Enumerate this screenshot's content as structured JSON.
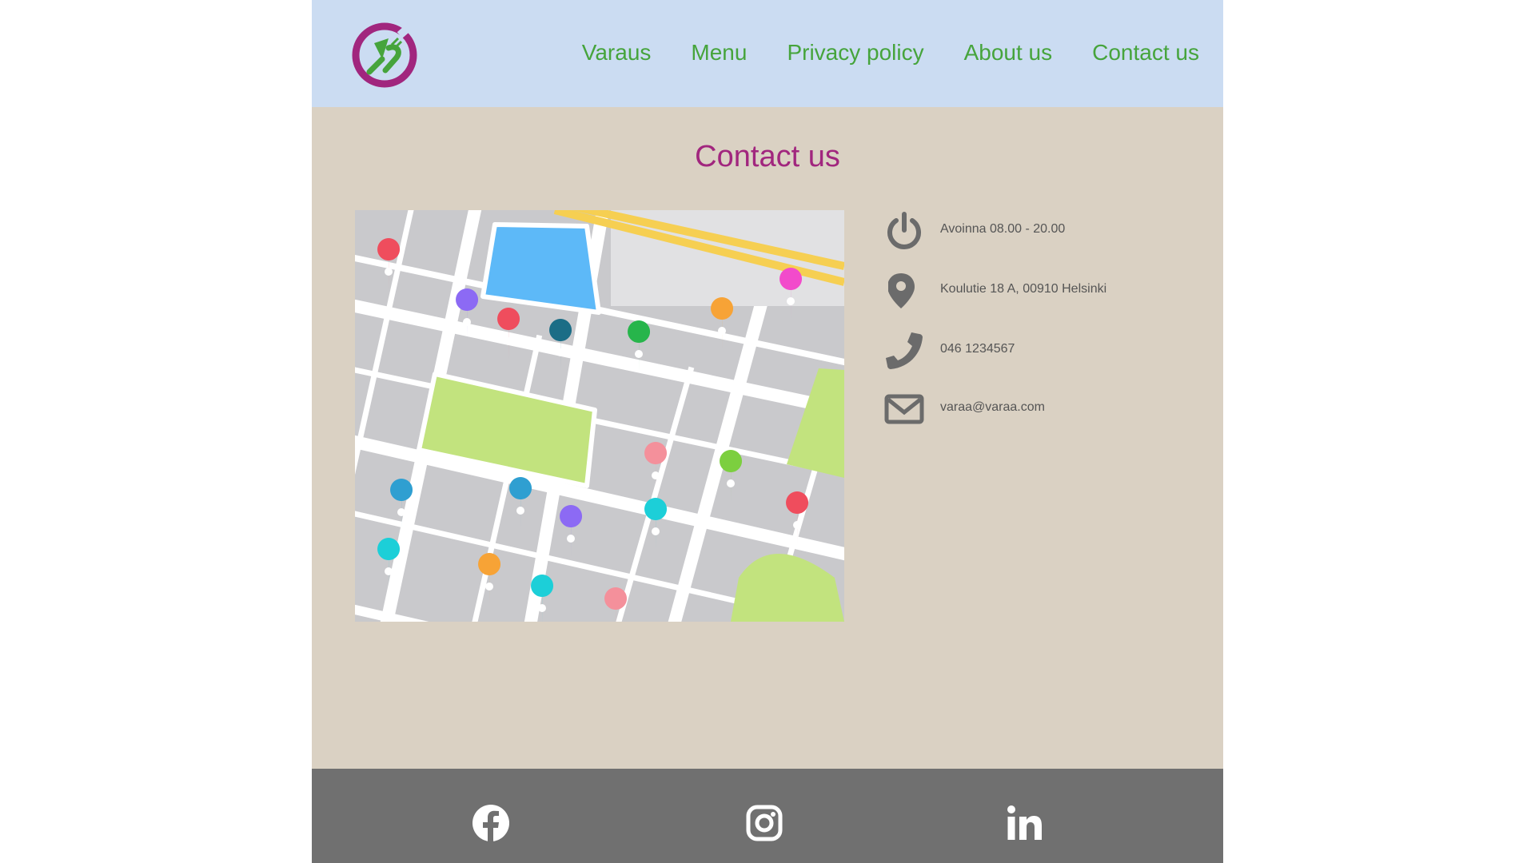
{
  "header": {
    "logo_icon": "restaurant-logo-icon",
    "nav": [
      {
        "label": "Varaus"
      },
      {
        "label": "Menu"
      },
      {
        "label": "Privacy policy"
      },
      {
        "label": "About us"
      },
      {
        "label": "Contact us"
      }
    ]
  },
  "main": {
    "title": "Contact us",
    "map_image": "city-map-image",
    "contact": [
      {
        "icon": "power-icon",
        "text": "Avoinna 08.00 - 20.00"
      },
      {
        "icon": "location-pin-icon",
        "text": "Koulutie 18 A, 00910 Helsinki"
      },
      {
        "icon": "phone-icon",
        "text": "046 1234567"
      },
      {
        "icon": "envelope-icon",
        "text": "varaa@varaa.com"
      }
    ]
  },
  "footer": {
    "social": [
      {
        "icon": "facebook-icon"
      },
      {
        "icon": "instagram-icon"
      },
      {
        "icon": "linkedin-icon"
      }
    ]
  },
  "colors": {
    "header_bg": "#cbdcf2",
    "nav_text": "#46a43c",
    "page_bg": "#dad1c3",
    "title": "#a1267e",
    "footer_bg": "#707070",
    "icon_gray": "#6b6b6b"
  }
}
